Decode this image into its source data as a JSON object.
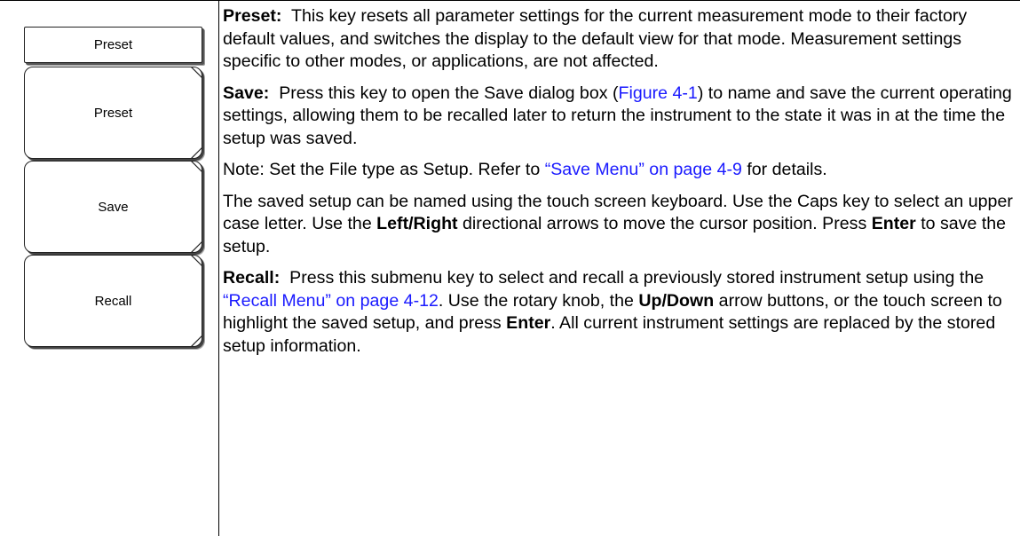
{
  "menu": {
    "title": "Preset",
    "keys": [
      {
        "label": "Preset"
      },
      {
        "label": "Save"
      },
      {
        "label": "Recall"
      }
    ]
  },
  "content": {
    "preset": {
      "term": "Preset:",
      "text": "This key resets all parameter settings for the current measurement mode to their factory default values, and switches the display to the default view for that mode. Measurement settings specific to other modes, or applications, are not affected."
    },
    "save": {
      "term": "Save:",
      "text_1": "Press this key to open the Save dialog box (",
      "link": "Figure 4-1",
      "text_2": ") to name and save the current operating settings, allowing them to be recalled later to return the instrument to the state it was in at the time the setup was saved."
    },
    "note": {
      "text_1": "Note: Set the File type as Setup. Refer to ",
      "link": "“Save Menu” on page 4-9",
      "text_2": " for details."
    },
    "naming": {
      "text_1": "The saved setup can be named using the touch screen keyboard. Use the Caps key to select an upper case letter. Use the ",
      "bold_1": "Left/Right",
      "text_2": " directional arrows to move the cursor position. Press ",
      "bold_2": "Enter",
      "text_3": " to save the setup."
    },
    "recall": {
      "term": "Recall:",
      "text_1": "Press this submenu key to select and recall a previously stored instrument setup using the ",
      "link": "“Recall Menu” on page 4-12",
      "text_2": ". Use the rotary knob, the ",
      "bold_1": "Up/Down",
      "text_3": " arrow buttons, or the touch screen to highlight the saved setup, and press ",
      "bold_2": "Enter",
      "text_4": ". All current instrument settings are replaced by the stored setup information."
    }
  }
}
